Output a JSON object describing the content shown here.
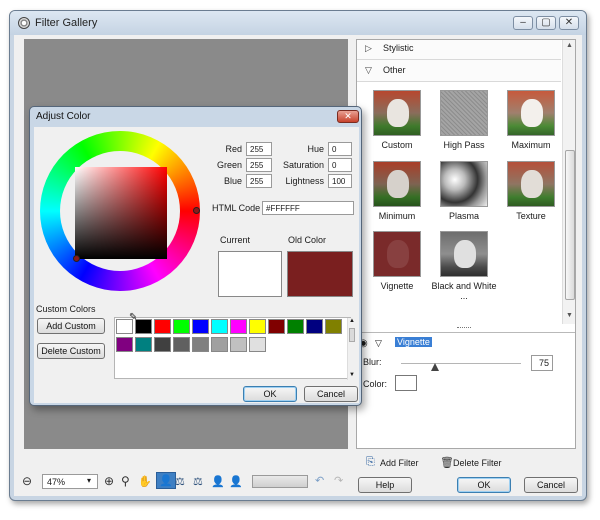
{
  "window": {
    "title": "Filter Gallery",
    "controls": [
      "–",
      "▢",
      "✕"
    ]
  },
  "filter_panel": {
    "categories": [
      {
        "label": "Stylistic",
        "arrow": "▷"
      },
      {
        "label": "Other",
        "arrow": "▽"
      }
    ],
    "filters": [
      {
        "label": "Custom",
        "style": "kitten"
      },
      {
        "label": "High Pass",
        "style": "gray"
      },
      {
        "label": "Maximum",
        "style": "kitten"
      },
      {
        "label": "Minimum",
        "style": "kitten"
      },
      {
        "label": "Plasma",
        "style": "plasma"
      },
      {
        "label": "Texture",
        "style": "kitten"
      },
      {
        "label": "Vignette",
        "style": "vignette"
      },
      {
        "label": "Black and White ...",
        "style": "bw"
      }
    ],
    "applied_filter": {
      "name": "Vignette",
      "blur_label": "Blur:",
      "blur_value": "75",
      "color_label": "Color:"
    },
    "add_filter_label": "Add Filter",
    "delete_filter_label": "Delete Filter"
  },
  "toolbar": {
    "zoom_value": "47%",
    "help_label": "Help",
    "ok_label": "OK",
    "cancel_label": "Cancel"
  },
  "dialog": {
    "title": "Adjust Color",
    "close_glyph": "✕",
    "fields": {
      "red_label": "Red",
      "red_value": "255",
      "green_label": "Green",
      "green_value": "255",
      "blue_label": "Blue",
      "blue_value": "255",
      "hue_label": "Hue",
      "hue_value": "0",
      "saturation_label": "Saturation",
      "saturation_value": "0",
      "lightness_label": "Lightness",
      "lightness_value": "100",
      "html_code_label": "HTML Code",
      "html_code_value": "#FFFFFF"
    },
    "current_label": "Current",
    "old_color_label": "Old Color",
    "current_color": "#ffffff",
    "old_color": "#7a1f1f",
    "custom_colors_label": "Custom Colors",
    "add_custom_label": "Add Custom",
    "delete_custom_label": "Delete Custom",
    "palette_row1": [
      "#ffffff",
      "#000000",
      "#ff0000",
      "#00ff00",
      "#0000ff",
      "#00ffff",
      "#ff00ff",
      "#ffff00",
      "#800000",
      "#008000",
      "#000080",
      "#808000"
    ],
    "palette_row2": [
      "#800080",
      "#008080",
      "#404040",
      "#606060",
      "#808080",
      "#a0a0a0",
      "#c0c0c0",
      "#e0e0e0"
    ],
    "ok_label": "OK",
    "cancel_label": "Cancel"
  }
}
